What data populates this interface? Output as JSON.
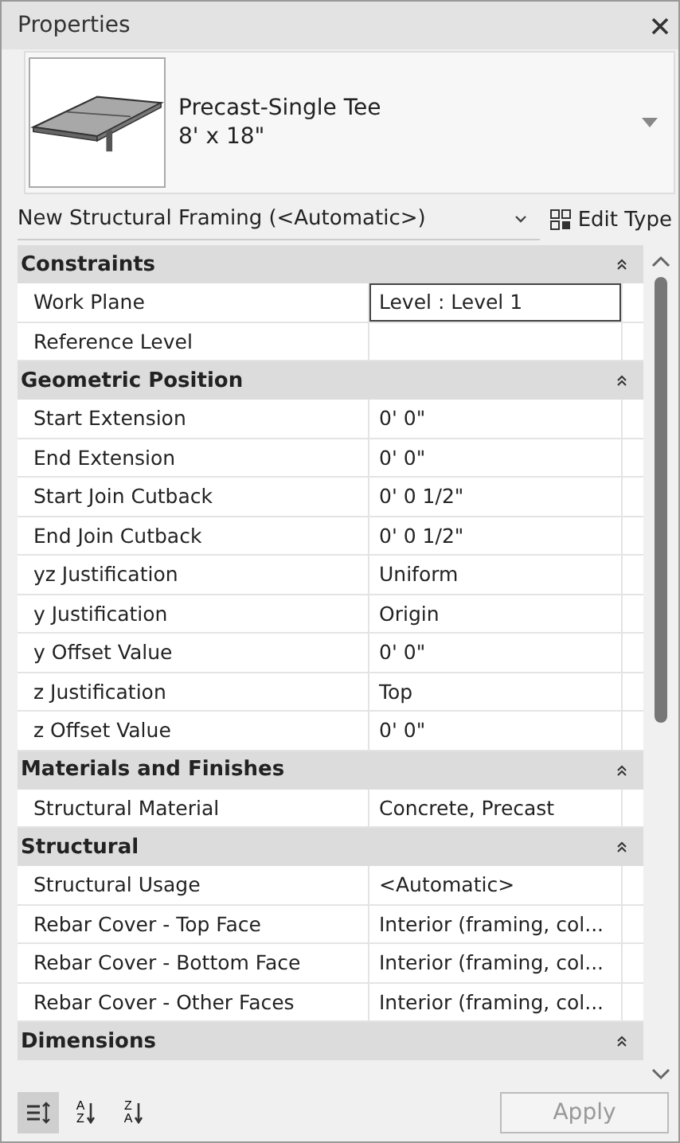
{
  "window": {
    "title": "Properties"
  },
  "type_selector": {
    "name": "Precast-Single Tee",
    "size": "8' x 18\""
  },
  "instance_filter": {
    "value": "New Structural Framing (<Automatic>)",
    "edit_type_label": "Edit Type"
  },
  "groups": [
    {
      "title": "Constraints",
      "expanded": true,
      "rows": [
        {
          "name": "Work Plane",
          "value": "Level : Level 1",
          "selected": true
        },
        {
          "name": "Reference Level",
          "selected": false
        }
      ]
    },
    {
      "title": "Geometric Position",
      "expanded": true,
      "rows": [
        {
          "name": "Start Extension",
          "value": "0'  0\"",
          "selected": false
        },
        {
          "name": "End Extension",
          "value": "0'  0\"",
          "selected": false
        },
        {
          "name": "Start Join Cutback",
          "value": "0'  0 1/2\"",
          "selected": false
        },
        {
          "name": "End Join Cutback",
          "value": "0'  0 1/2\"",
          "selected": false
        },
        {
          "name": "yz Justification",
          "value": "Uniform",
          "selected": false
        },
        {
          "name": "y Justification",
          "value": "Origin",
          "selected": false
        },
        {
          "name": "y Offset Value",
          "value": "0'  0\"",
          "selected": false
        },
        {
          "name": "z Justification",
          "value": "Top",
          "selected": false
        },
        {
          "name": "z Offset Value",
          "value": "0'  0\"",
          "selected": false
        }
      ]
    },
    {
      "title": "Materials and Finishes",
      "expanded": true,
      "rows": [
        {
          "name": "Structural Material",
          "value": "Concrete, Precast",
          "selected": false
        }
      ]
    },
    {
      "title": "Structural",
      "expanded": true,
      "rows": [
        {
          "name": "Structural Usage",
          "value": "<Automatic>",
          "selected": false
        },
        {
          "name": "Rebar Cover - Top Face",
          "value": "Interior (framing, col...",
          "selected": false
        },
        {
          "name": "Rebar Cover - Bottom Face",
          "value": "Interior (framing, col...",
          "selected": false
        },
        {
          "name": "Rebar Cover - Other Faces",
          "value": "Interior (framing, col...",
          "selected": false
        }
      ]
    },
    {
      "title": "Dimensions",
      "expanded": true
    }
  ],
  "sort_buttons": [
    {
      "kind": "categorized",
      "selected": true
    },
    {
      "kind": "ascending",
      "top": "A",
      "bottom": "Z",
      "selected": false
    },
    {
      "kind": "descending",
      "top": "Z",
      "bottom": "A",
      "selected": false
    }
  ],
  "apply_button": {
    "label": "Apply",
    "disabled": true
  }
}
